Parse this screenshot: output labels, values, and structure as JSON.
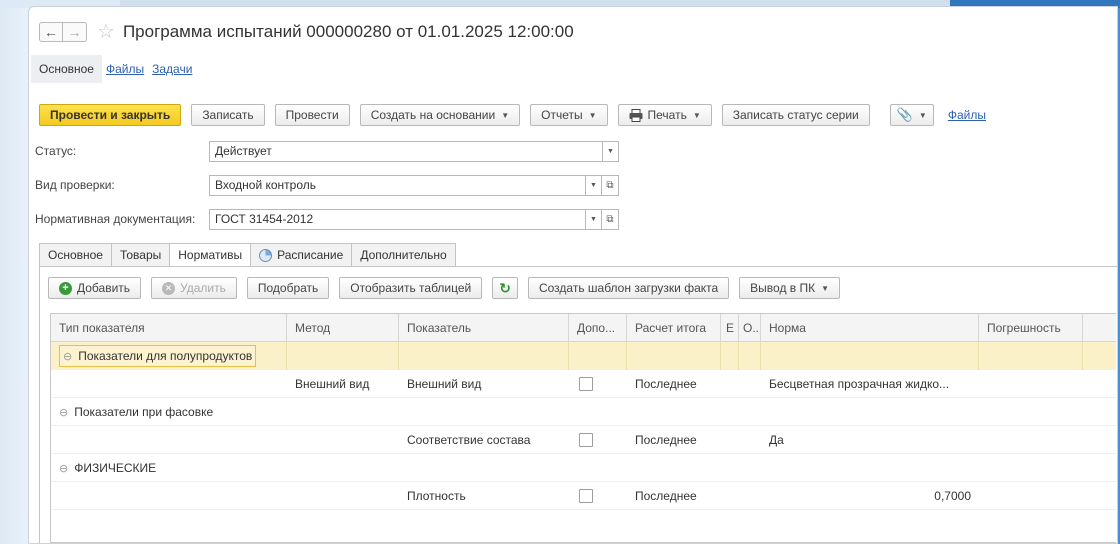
{
  "window": {
    "title": "Программа испытаний 000000280 от 01.01.2025 12:00:00"
  },
  "nav": {
    "items": [
      {
        "label": "Основное",
        "active": true
      },
      {
        "label": "Файлы",
        "active": false
      },
      {
        "label": "Задачи",
        "active": false
      }
    ]
  },
  "toolbar": {
    "post_close": "Провести и закрыть",
    "save": "Записать",
    "post": "Провести",
    "create_based": "Создать на основании",
    "reports": "Отчеты",
    "print": "Печать",
    "record_series": "Записать статус серии",
    "files_link": "Файлы"
  },
  "form": {
    "status_label": "Статус:",
    "status_value": "Действует",
    "check_label": "Вид проверки:",
    "check_value": "Входной контроль",
    "norm_label": "Нормативная документация:",
    "norm_value": "ГОСТ 31454-2012"
  },
  "tabs": [
    {
      "label": "Основное",
      "active": false
    },
    {
      "label": "Товары",
      "active": false
    },
    {
      "label": "Нормативы",
      "active": true
    },
    {
      "label": "Расписание",
      "active": false
    },
    {
      "label": "Дополнительно",
      "active": false
    }
  ],
  "table_toolbar": {
    "add": "Добавить",
    "delete": "Удалить",
    "pick": "Подобрать",
    "show_table": "Отобразить таблицей",
    "create_template": "Создать шаблон загрузки факта",
    "output_pc": "Вывод в ПК"
  },
  "table": {
    "headers": [
      "Тип показателя",
      "Метод",
      "Показатель",
      "Допо...",
      "Расчет итога",
      "Е",
      "О..",
      "Норма",
      "Погрешность"
    ],
    "rows": [
      {
        "group": "Показатели для полупродуктов",
        "selected": true
      },
      {
        "cells": [
          "",
          "Внешний вид",
          "Внешний вид",
          "",
          "Последнее",
          "",
          "",
          "Бесцветная прозрачная жидко...",
          ""
        ]
      },
      {
        "group": "Показатели при фасовке",
        "selected": false
      },
      {
        "cells": [
          "",
          "",
          "Соответствие состава",
          "",
          "Последнее",
          "",
          "",
          "Да",
          ""
        ]
      },
      {
        "group": "ФИЗИЧЕСКИЕ",
        "selected": false
      },
      {
        "cells": [
          "",
          "",
          "Плотность",
          "",
          "Последнее",
          "",
          "",
          "0,7000",
          ""
        ]
      }
    ]
  }
}
